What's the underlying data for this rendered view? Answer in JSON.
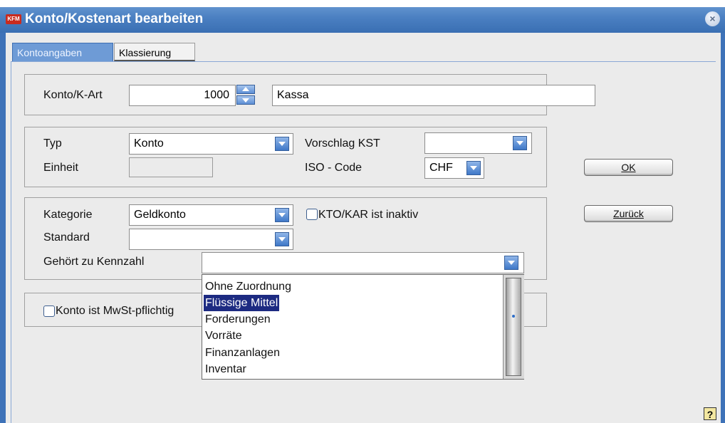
{
  "window": {
    "title": "Konto/Kostenart bearbeiten",
    "app_icon": "KFM"
  },
  "tabs": [
    {
      "label": "Kontoangaben",
      "active": true
    },
    {
      "label": "Klassierung",
      "active": false
    }
  ],
  "konto": {
    "label": "Konto/K-Art",
    "number": "1000",
    "name": "Kassa"
  },
  "typ": {
    "typ_label": "Typ",
    "typ_value": "Konto",
    "einheit_label": "Einheit",
    "einheit_value": "",
    "vorschlag_label": "Vorschlag KST",
    "vorschlag_value": "",
    "iso_label": "ISO - Code",
    "iso_value": "CHF"
  },
  "kategorie": {
    "kategorie_label": "Kategorie",
    "kategorie_value": "Geldkonto",
    "inaktiv_label": "KTO/KAR ist inaktiv",
    "inaktiv_checked": false,
    "standard_label": "Standard",
    "standard_value": "",
    "kennzahl_label": "Gehört zu Kennzahl",
    "kennzahl_value": ""
  },
  "mwst": {
    "label": "Konto ist MwSt-pflichtig",
    "checked": false
  },
  "dropdown_options": [
    {
      "label": "Ohne Zuordnung",
      "selected": false
    },
    {
      "label": "Flüssige Mittel",
      "selected": true
    },
    {
      "label": "Forderungen",
      "selected": false
    },
    {
      "label": "Vorräte",
      "selected": false
    },
    {
      "label": "Finanzanlagen",
      "selected": false
    },
    {
      "label": "Inventar",
      "selected": false
    }
  ],
  "buttons": {
    "ok": "OK",
    "zurueck": "Zurück"
  },
  "help": "?",
  "colors": {
    "titlebar": "#4a7fc1",
    "selection": "#1d2b82",
    "accent": "#3e72b8"
  }
}
